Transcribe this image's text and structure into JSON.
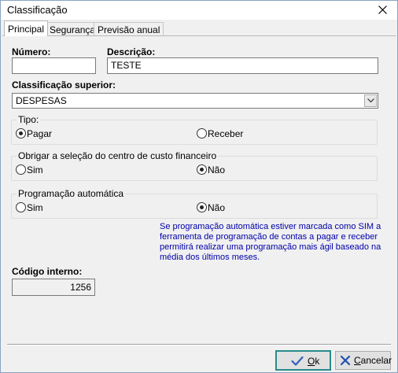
{
  "window": {
    "title": "Classificação"
  },
  "tabs": [
    {
      "label": "Principal",
      "active": true
    },
    {
      "label": "Segurança",
      "active": false
    },
    {
      "label": "Previsão anual",
      "active": false
    }
  ],
  "form": {
    "numero": {
      "label": "Número:",
      "value": ""
    },
    "descricao": {
      "label": "Descrição:",
      "value": "TESTE"
    },
    "classificacao_superior": {
      "label": "Classificação superior:",
      "value": "DESPESAS"
    },
    "tipo": {
      "caption": "Tipo:",
      "options": [
        {
          "label": "Pagar",
          "selected": true
        },
        {
          "label": "Receber",
          "selected": false
        }
      ]
    },
    "centro_custo": {
      "caption": "Obrigar a seleção do centro de custo financeiro",
      "options": [
        {
          "label": "Sim",
          "selected": false
        },
        {
          "label": "Não",
          "selected": true
        }
      ]
    },
    "programacao": {
      "caption": "Programação automática",
      "options": [
        {
          "label": "Sim",
          "selected": false
        },
        {
          "label": "Não",
          "selected": true
        }
      ]
    },
    "info_text": "Se programação automática estiver marcada como SIM a ferramenta de programação de contas a pagar e receber permitirá realizar uma programação mais ágil baseado na média dos últimos meses.",
    "codigo_interno": {
      "label": "Código interno:",
      "value": "1256"
    }
  },
  "buttons": {
    "ok": {
      "underlined": "O",
      "rest": "k",
      "icon": "check-icon"
    },
    "cancel": {
      "underlined": "C",
      "rest": "ancelar",
      "icon": "cancel-x-icon"
    }
  },
  "colors": {
    "info_text": "#0000aa",
    "ok_icon": "#3060c0",
    "cancel_icon": "#2050b0",
    "default_button_border": "#2a8b8b"
  }
}
